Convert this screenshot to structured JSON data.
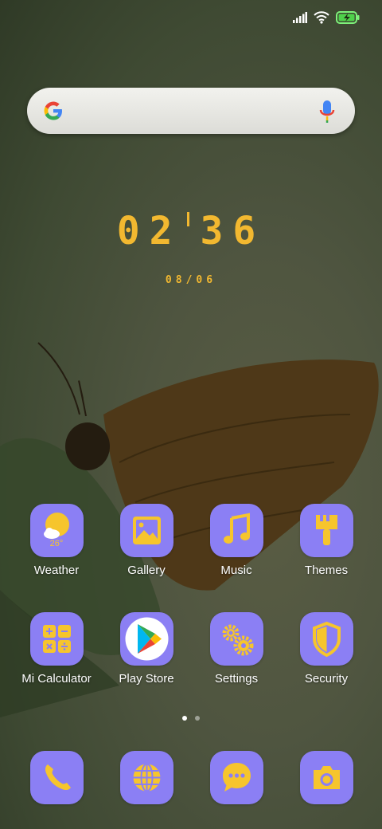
{
  "colors": {
    "icon_bg": "#8b7ff4",
    "accent": "#f2b830",
    "label": "#ffffff"
  },
  "status_bar": {
    "icons": [
      "signal-icon",
      "wifi-icon",
      "battery-charging-icon"
    ]
  },
  "search": {
    "placeholder": "",
    "icons": [
      "google-logo-icon",
      "microphone-icon"
    ]
  },
  "clock": {
    "hours": "02",
    "minutes": "36",
    "date": "08/06"
  },
  "apps_row1": [
    {
      "label": "Weather",
      "icon": "weather-icon",
      "temp": "26°"
    },
    {
      "label": "Gallery",
      "icon": "gallery-icon"
    },
    {
      "label": "Music",
      "icon": "music-icon"
    },
    {
      "label": "Themes",
      "icon": "themes-brush-icon"
    }
  ],
  "apps_row2": [
    {
      "label": "Mi Calculator",
      "icon": "calculator-icon"
    },
    {
      "label": "Play Store",
      "icon": "play-store-icon"
    },
    {
      "label": "Settings",
      "icon": "settings-gears-icon"
    },
    {
      "label": "Security",
      "icon": "security-shield-icon"
    }
  ],
  "page_indicator": {
    "pages": 2,
    "current": 1
  },
  "dock": [
    {
      "icon": "phone-icon"
    },
    {
      "icon": "browser-globe-icon"
    },
    {
      "icon": "messages-icon"
    },
    {
      "icon": "camera-icon"
    }
  ]
}
